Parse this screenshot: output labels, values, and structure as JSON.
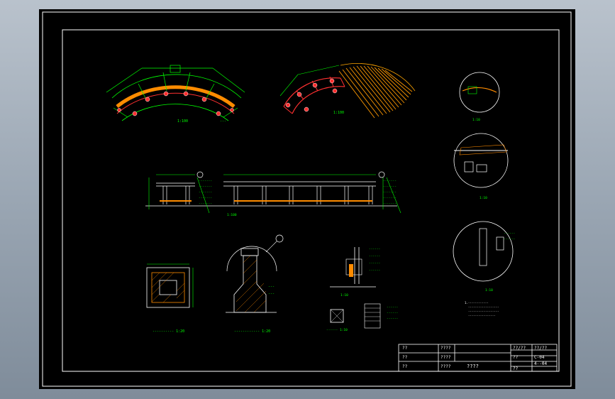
{
  "title_block": {
    "row1_label": "??",
    "row2_label": "??",
    "row3_label": "??",
    "row1_value": "????",
    "row2_value": "????",
    "row3_value": "????",
    "drawing_name": "????",
    "field_a1": "??/??",
    "field_a2": "??",
    "field_a3": "??",
    "field_b1": "??/??",
    "field_b2": "C-04",
    "field_b3": "4--04"
  }
}
